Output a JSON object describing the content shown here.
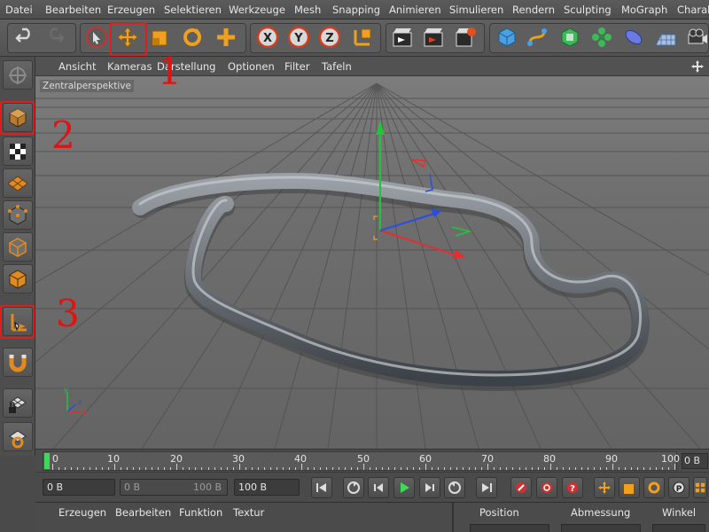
{
  "menubar": {
    "items": [
      "Datei",
      "Bearbeiten",
      "Erzeugen",
      "Selektieren",
      "Werkzeuge",
      "Mesh",
      "Snapping",
      "Animieren",
      "Simulieren",
      "Rendern",
      "Sculpting",
      "MoGraph",
      "Charak"
    ]
  },
  "toolbar": {
    "icons": [
      "undo-icon",
      "redo-icon",
      "select-arrow-icon",
      "move-icon",
      "scale-icon",
      "rotate-icon",
      "add-axis-icon",
      "x-axis-lock-icon",
      "y-axis-lock-icon",
      "z-axis-lock-icon",
      "coordinate-system-icon",
      "render-view-icon",
      "render-picture-icon",
      "render-settings-icon",
      "cube-icon",
      "spline-icon",
      "nurbs-icon",
      "mograph-cloner-icon",
      "deformer-icon",
      "floor-icon",
      "camera-icon"
    ],
    "x_label": "X",
    "y_label": "Y",
    "z_label": "Z"
  },
  "viewport_menu": {
    "items": [
      "Ansicht",
      "Kameras",
      "Darstellung",
      "Optionen",
      "Filter",
      "Tafeln"
    ],
    "view_name": "Zentralperspektive"
  },
  "annotations": [
    "1",
    "2",
    "3"
  ],
  "timeline": {
    "ticks": [
      "0",
      "10",
      "20",
      "30",
      "40",
      "50",
      "60",
      "70",
      "80",
      "90",
      "100"
    ],
    "current_frame": "0 B"
  },
  "transport": {
    "start_field": "0 B",
    "range_min": "0 B",
    "range_max": "100 B",
    "end_field": "100 B"
  },
  "bottom_panels": {
    "material_menu": [
      "Erzeugen",
      "Bearbeiten",
      "Funktion",
      "Textur"
    ],
    "coord_headers": [
      "Position",
      "Abmessung",
      "Winkel"
    ]
  },
  "colors": {
    "accent_highlight": "#e01d1d",
    "axis_x": "#e03030",
    "axis_y": "#22c43a",
    "axis_z": "#2a4fe0",
    "tool_orange": "#f0a020"
  }
}
